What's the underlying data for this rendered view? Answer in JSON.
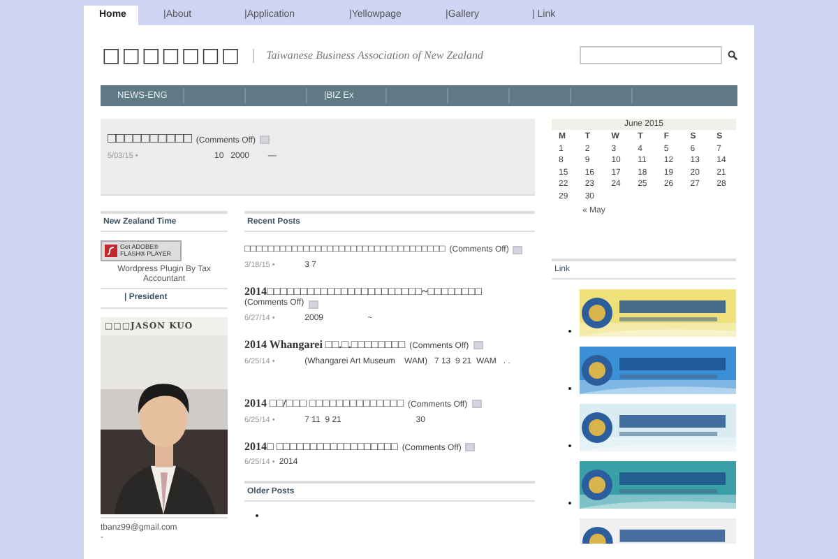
{
  "tabs": [
    {
      "label": "Home",
      "selected": true
    },
    {
      "label": "|About",
      "selected": false
    },
    {
      "label": "|Application",
      "selected": false
    },
    {
      "label": "|Yellowpage",
      "selected": false
    },
    {
      "label": "|Gallery",
      "selected": false
    },
    {
      "label": "| Link",
      "selected": false
    }
  ],
  "header": {
    "logo": "□□□□□□□",
    "tagline": "Taiwanese Business Association of New Zealand"
  },
  "nav": [
    {
      "label": "NEWS-ENG"
    },
    {
      "label": "|BIZ Ex"
    }
  ],
  "featured": {
    "title": "□□□□□□□□□□",
    "comments": "(Comments Off)",
    "date": "5/03/15 •",
    "excerpt": "10   2000        —"
  },
  "sidebar": {
    "time_heading": "New Zealand Time",
    "flash_badge": {
      "line1": "Get ADOBE®",
      "line2": "FLASH® PLAYER"
    },
    "plugin_text": "Wordpress Plugin By Tax Accountant",
    "president_link": "| President",
    "profile_heading": "□□□JASON KUO",
    "email": "tbanz99@gmail.com",
    "dash": "-"
  },
  "recent": {
    "heading": "Recent Posts",
    "posts": [
      {
        "title": "□□□□□□□□□□□□□□□□□□□□□□□□□□□□□□□□□□",
        "comments": "(Comments Off)",
        "date": "3/18/15 •",
        "excerpt": "           3 7"
      },
      {
        "title": "2014□□□□□□□□□□□□□□□□□□□□□□□~□□□□□□□□",
        "comments": "(Comments Off)",
        "date": "6/27/14 •",
        "excerpt": "           2009                   ~"
      },
      {
        "title": "2014 Whangarei □□.□.□□□□□□□□",
        "comments": "(Comments Off)",
        "date": "6/25/14 •",
        "excerpt": "           (Whangarei Art Museum    WAM)   7 13  9 21  WAM   . ."
      },
      {
        "title": "2014 □□/□□□ □□□□□□□□□□□□□□",
        "comments": "(Comments Off)",
        "date": "6/25/14 •",
        "excerpt": "           7 11  9 21                                30"
      },
      {
        "title": "2014□ □□□□□□□□□□□□□□□□□□",
        "comments": "(Comments Off)",
        "date": "6/25/14 •",
        "excerpt": "2014"
      }
    ],
    "older_heading": "Older Posts"
  },
  "calendar": {
    "caption": "June 2015",
    "days": [
      "M",
      "T",
      "W",
      "T",
      "F",
      "S",
      "S"
    ],
    "weeks": [
      [
        "1",
        "2",
        "3",
        "4",
        "5",
        "6",
        "7"
      ],
      [
        "8",
        "9",
        "10",
        "11",
        "12",
        "13",
        "14"
      ],
      [
        "15",
        "16",
        "17",
        "18",
        "19",
        "20",
        "21"
      ],
      [
        "22",
        "23",
        "24",
        "25",
        "26",
        "27",
        "28"
      ],
      [
        "29",
        "30"
      ]
    ],
    "prev": "« May"
  },
  "links": {
    "heading": "Link"
  }
}
